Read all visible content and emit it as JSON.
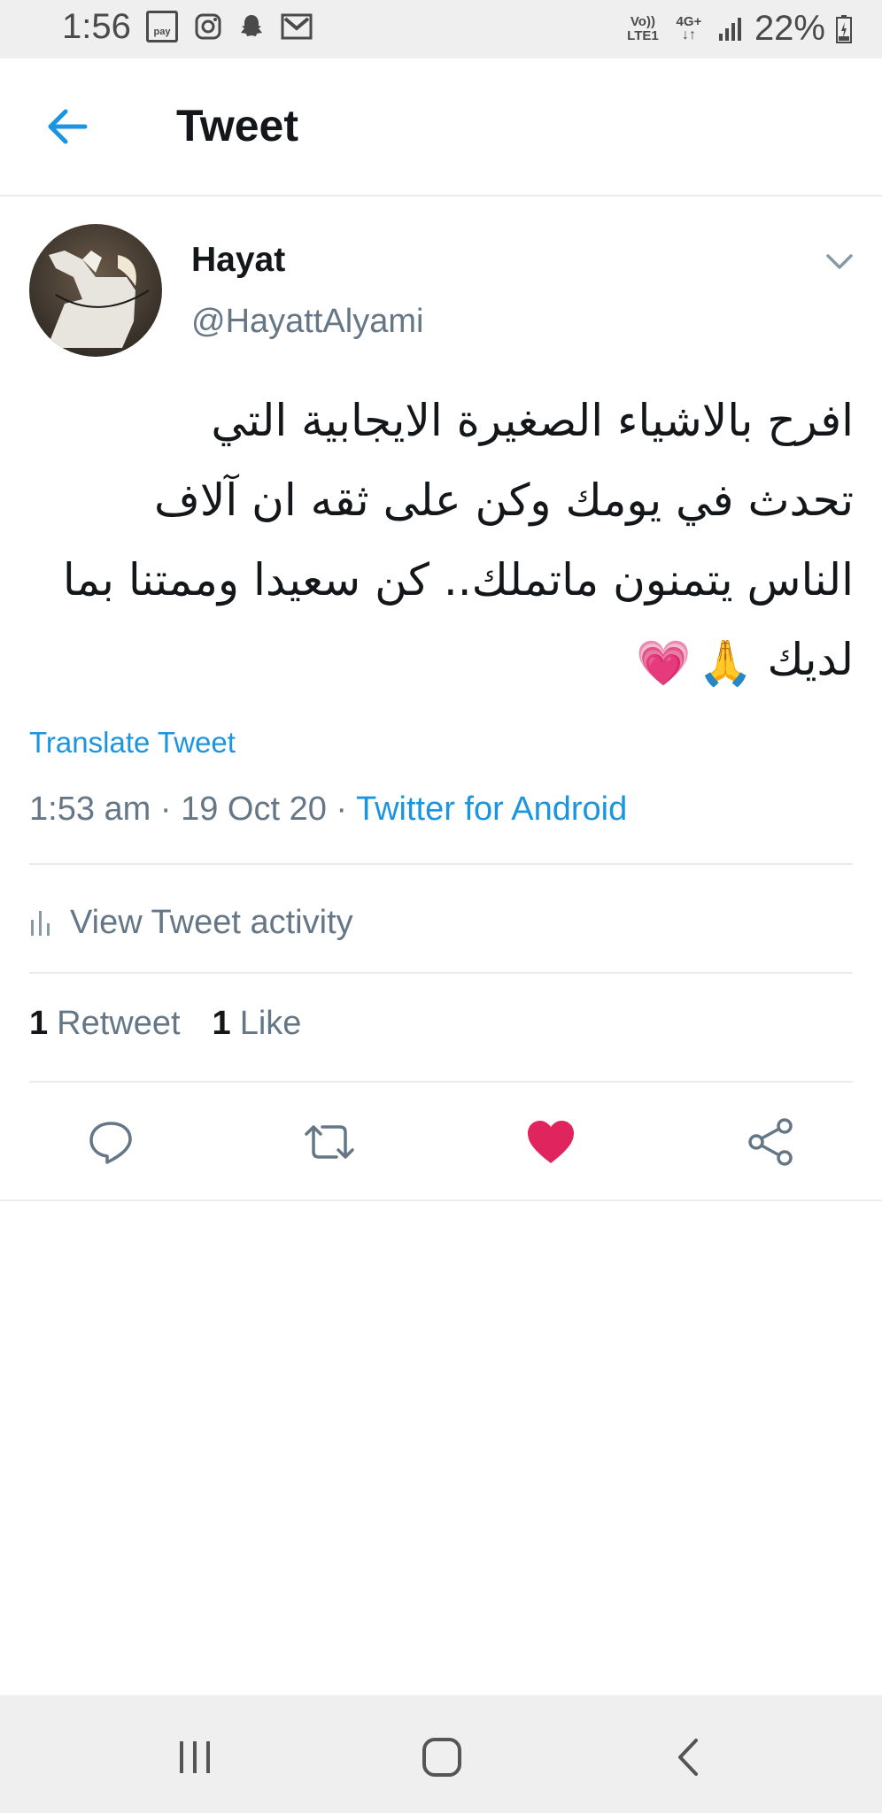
{
  "status_bar": {
    "time": "1:56",
    "pay_label": "pay",
    "network": "4G+",
    "volte": "Vo)) LTE1",
    "battery": "22%"
  },
  "app_bar": {
    "title": "Tweet"
  },
  "tweet": {
    "author_name": "Hayat",
    "author_handle": "@HayattAlyami",
    "text_lines": [
      "افرح بالاشياء الصغيرة الايجابية التي",
      "تحدث في يومك وكن على ثقه ان آلاف",
      "الناس يتمنون ماتملك.. كن سعيدا وممتنا بما",
      "لديك"
    ],
    "emojis": [
      "🙏",
      "💗"
    ],
    "translate_label": "Translate Tweet",
    "time": "1:53 am",
    "date": "19 Oct 20",
    "separator": "·",
    "source": "Twitter for Android",
    "activity_label": "View Tweet activity",
    "retweet_count": "1",
    "retweet_label": "Retweet",
    "like_count": "1",
    "like_label": "Like"
  },
  "colors": {
    "accent": "#1b95e0",
    "like": "#e0245e",
    "secondary_text": "#657786",
    "divider": "#e6ecf0"
  },
  "icons": {
    "back": "arrow-left-icon",
    "caret": "chevron-down-icon",
    "activity": "bar-chart-icon",
    "reply": "reply-icon",
    "retweet": "retweet-icon",
    "like": "heart-filled-icon",
    "share": "share-icon"
  }
}
